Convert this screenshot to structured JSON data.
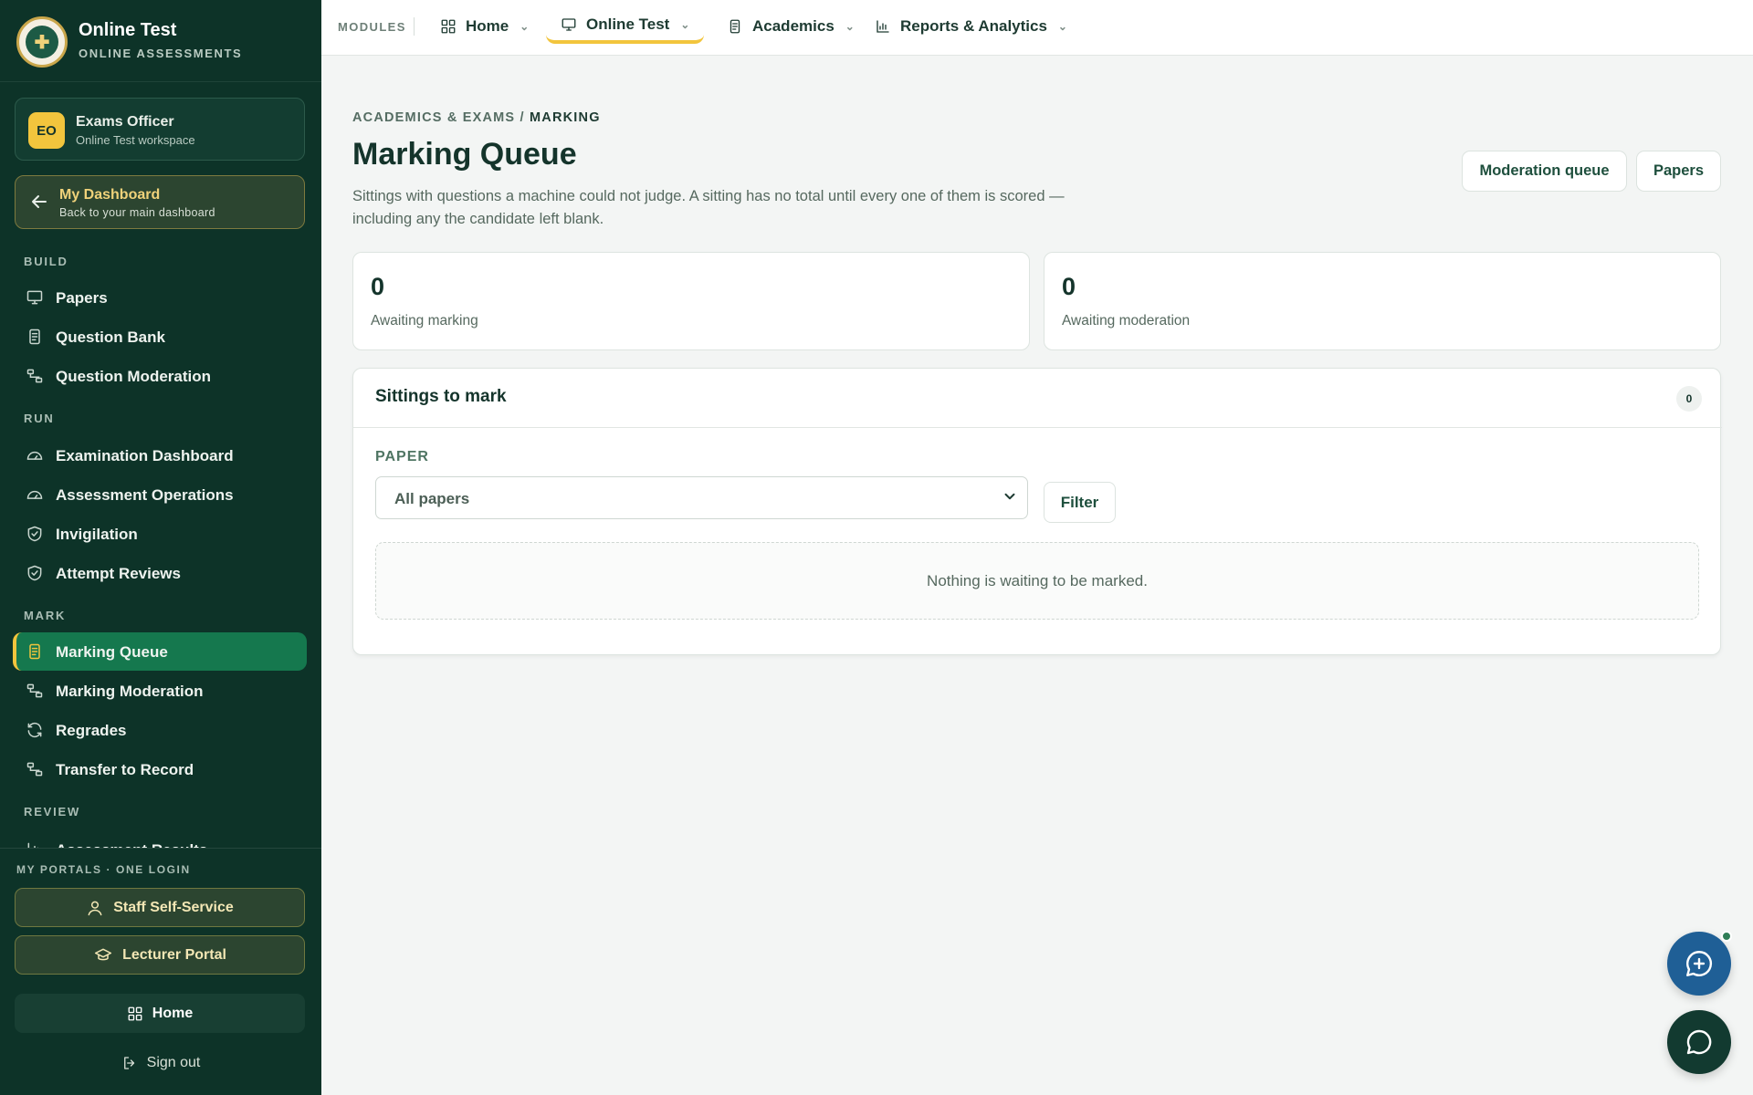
{
  "brand": {
    "title": "Online Test",
    "subtitle": "ONLINE ASSESSMENTS"
  },
  "user": {
    "initials": "EO",
    "name": "Exams Officer",
    "workspace": "Online Test workspace"
  },
  "dashboard_link": {
    "title": "My Dashboard",
    "subtitle": "Back to your main dashboard"
  },
  "sidebar": {
    "sections": {
      "build": "BUILD",
      "run": "RUN",
      "mark": "MARK",
      "review": "REVIEW"
    },
    "items": {
      "papers": "Papers",
      "question_bank": "Question Bank",
      "question_moderation": "Question Moderation",
      "examination_dashboard": "Examination Dashboard",
      "assessment_operations": "Assessment Operations",
      "invigilation": "Invigilation",
      "attempt_reviews": "Attempt Reviews",
      "marking_queue": "Marking Queue",
      "marking_moderation": "Marking Moderation",
      "regrades": "Regrades",
      "transfer_to_record": "Transfer to Record",
      "assessment_results": "Assessment Results"
    },
    "portals_label": "MY PORTALS · ONE LOGIN",
    "staff_self_service": "Staff Self-Service",
    "lecturer_portal": "Lecturer Portal",
    "home": "Home",
    "sign_out": "Sign out"
  },
  "topbar": {
    "modules_label": "MODULES",
    "tabs": {
      "home": "Home",
      "online_test": "Online Test",
      "academics": "Academics",
      "reports": "Reports & Analytics"
    }
  },
  "main": {
    "breadcrumb_parent": "ACADEMICS & EXAMS",
    "breadcrumb_sep": " / ",
    "breadcrumb_current": "MARKING",
    "title": "Marking Queue",
    "description": "Sittings with questions a machine could not judge. A sitting has no total until every one of them is scored — including any the candidate left blank.",
    "moderation_queue_button": "Moderation queue",
    "papers_button": "Papers",
    "stats": {
      "awaiting_marking": {
        "value": "0",
        "label": "Awaiting marking"
      },
      "awaiting_moderation": {
        "value": "0",
        "label": "Awaiting moderation"
      }
    },
    "panel": {
      "title": "Sittings to mark",
      "count": "0",
      "paper_label": "PAPER",
      "paper_select": "All papers",
      "filter_button": "Filter",
      "empty_message": "Nothing is waiting to be marked."
    }
  },
  "colors": {
    "sidebar_bg": "#0d3328",
    "active_nav": "#15784e",
    "accent_yellow": "#f2c53d",
    "assistant_fab": "#1f5f96",
    "chat_fab": "#123a30"
  },
  "icons": {
    "assistant_fab": "sparkle-chat-icon",
    "chat_fab": "chat-bubble-icon"
  }
}
